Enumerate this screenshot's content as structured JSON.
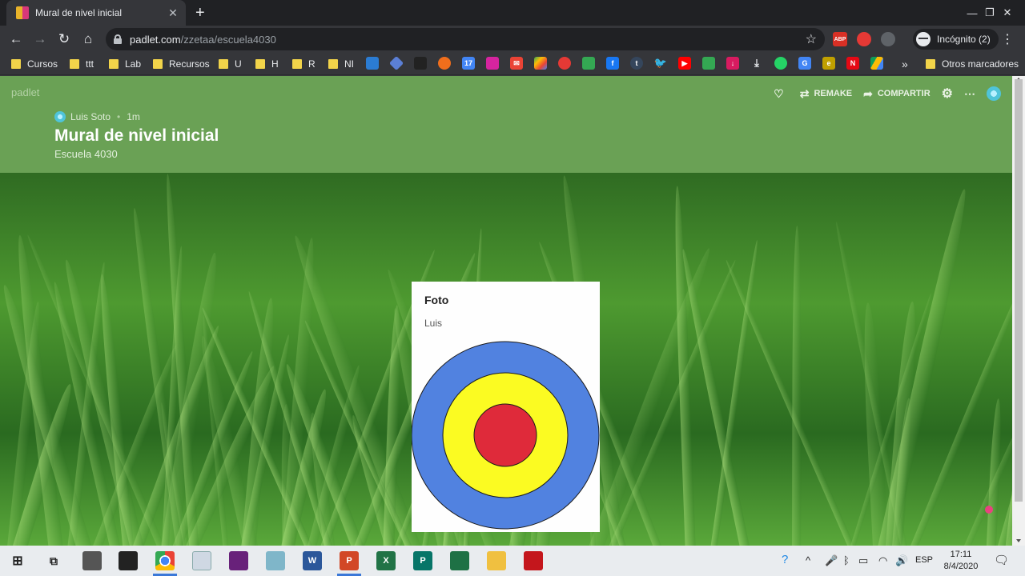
{
  "browser": {
    "tab_title": "Mural de nivel inicial",
    "url_host": "padlet.com",
    "url_path": "/zzetaa/escuela4030",
    "incognito_label": "Incógnito (2)",
    "bookmarks": [
      "Cursos",
      "ttt",
      "Lab",
      "Recursos",
      "U",
      "H",
      "R",
      "NI"
    ],
    "other_bookmarks": "Otros marcadores",
    "extensions": [
      "ABP"
    ]
  },
  "padlet": {
    "logo": "padlet",
    "actions": {
      "remake": "REMAKE",
      "share": "COMPARTIR"
    },
    "author": "Luis Soto",
    "time": "1m",
    "title": "Mural de nivel inicial",
    "subtitle": "Escuela 4030",
    "post": {
      "title": "Foto",
      "body": "Luis",
      "image_colors": {
        "outer": "#5182e0",
        "middle": "#fbfb22",
        "inner": "#df2a3a"
      }
    }
  },
  "taskbar": {
    "lang": "ESP",
    "time": "17:11",
    "date": "8/4/2020"
  }
}
